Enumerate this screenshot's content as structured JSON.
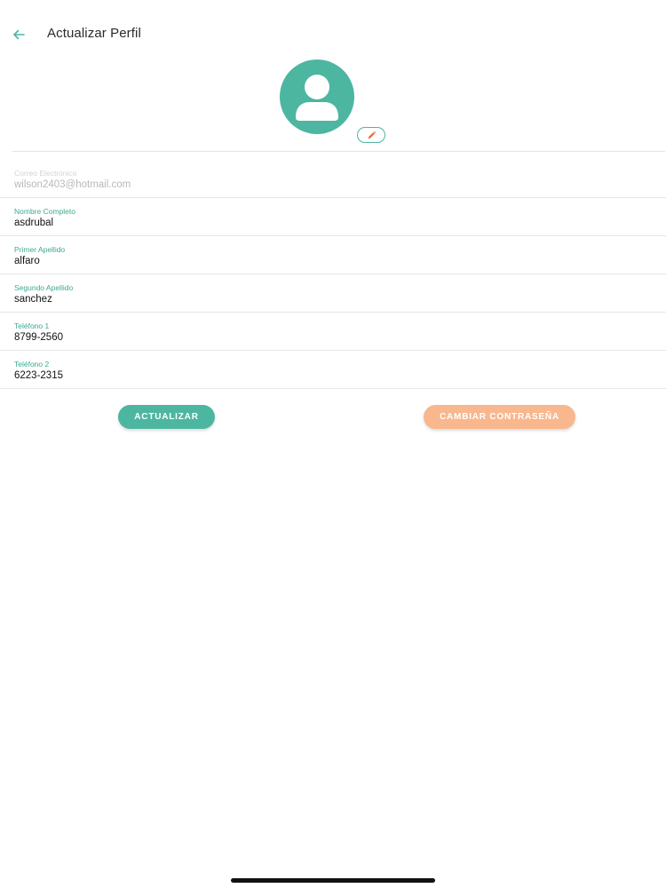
{
  "header": {
    "title": "Actualizar Perfil",
    "back_icon": "arrow-left-icon"
  },
  "avatar": {
    "icon": "user-icon",
    "edit_icon": "pencil-icon"
  },
  "colors": {
    "accent": "#4db6a0",
    "secondary": "#f9b78e",
    "edit_pencil": "#e8702a"
  },
  "fields": [
    {
      "label": "Correo Electrónico",
      "value": "wilson2403@hotmail.com",
      "disabled": true
    },
    {
      "label": "Nombre Completo",
      "value": "asdrubal",
      "disabled": false
    },
    {
      "label": "Primer Apellido",
      "value": "alfaro",
      "disabled": false
    },
    {
      "label": "Segundo Apellido",
      "value": "sanchez",
      "disabled": false
    },
    {
      "label": "Teléfono 1",
      "value": "8799-2560",
      "disabled": false
    },
    {
      "label": "Teléfono 2",
      "value": "6223-2315",
      "disabled": false
    }
  ],
  "buttons": {
    "update_label": "ACTUALIZAR",
    "change_password_label": "CAMBIAR CONTRASEÑA"
  }
}
